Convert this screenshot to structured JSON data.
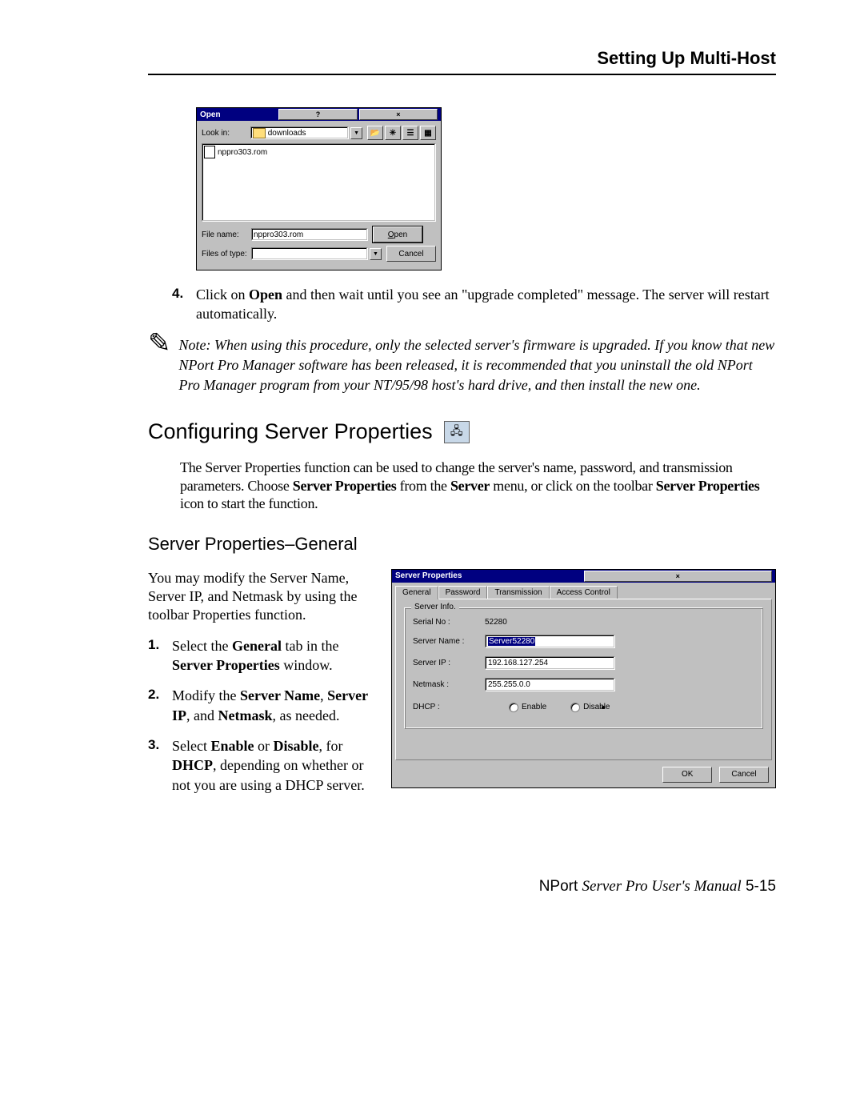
{
  "header": {
    "title": "Setting Up Multi-Host"
  },
  "open_dialog": {
    "title": "Open",
    "help_glyph": "?",
    "close_glyph": "×",
    "look_in_label": "Look in:",
    "look_in_value": "downloads",
    "up_glyph": "📂",
    "new_glyph": "✳",
    "list_glyph": "☰",
    "detail_glyph": "▦",
    "file_item": "nppro303.rom",
    "filename_label": "File name:",
    "filename_value": "nppro303.rom",
    "filetype_label": "Files of type:",
    "filetype_value": "",
    "open_btn": "Open",
    "cancel_btn": "Cancel"
  },
  "step4": {
    "num": "4.",
    "text_a": "Click on ",
    "bold_a": "Open",
    "text_b": " and then wait until you see an \"upgrade completed\" message. The server will restart automatically."
  },
  "note": {
    "icon": "✎",
    "text": "Note: When using this procedure, only the selected server's firmware is upgraded. If you know that new NPort Pro Manager software has been released, it is recommended that you uninstall the old NPort Pro Manager program from your NT/95/98 host's hard drive, and then install the new one."
  },
  "section": {
    "title": "Configuring Server Properties",
    "icon": "🖧"
  },
  "intro": {
    "pre": "The Server Properties function can be used to change the server's name, password, and transmission parameters. Choose ",
    "b1": "Server Properties",
    "mid1": " from the ",
    "b2": "Server",
    "mid2": " menu, or click on the toolbar ",
    "b3": "Server Properties",
    "post": " icon to start the function."
  },
  "subsection": {
    "title": "Server Properties–General"
  },
  "left": {
    "p1": "You may modify the Server Name, Server IP, and Netmask by using the toolbar Properties function.",
    "s1": {
      "num": "1.",
      "a": "Select the ",
      "b1": "General",
      "mid": " tab in the ",
      "b2": "Server Properties",
      "end": " window."
    },
    "s2": {
      "num": "2.",
      "a": "Modify the ",
      "b1": "Server Name",
      "c": ", ",
      "b2": "Server IP",
      "d": ", and ",
      "b3": "Netmask",
      "e": ", as needed."
    },
    "s3": {
      "num": "3.",
      "a": "Select ",
      "b1": "Enable",
      "mid": " or ",
      "b2": "Disable",
      "mid2": ", for ",
      "b3": "DHCP",
      "e": ", depending on whether or not you are using a DHCP server."
    }
  },
  "sp_dialog": {
    "title": "Server Properties",
    "close_glyph": "×",
    "tabs": [
      "General",
      "Password",
      "Transmission",
      "Access Control"
    ],
    "group_title": "Server Info.",
    "serial_lbl": "Serial No :",
    "serial_val": "52280",
    "name_lbl": "Server Name :",
    "name_val": "Server52280",
    "ip_lbl": "Server IP :",
    "ip_val": "192.168.127.254",
    "mask_lbl": "Netmask :",
    "mask_val": "255.255.0.0",
    "dhcp_lbl": "DHCP :",
    "enable": "Enable",
    "disable": "Disable",
    "ok": "OK",
    "cancel": "Cancel"
  },
  "footer": {
    "a": "NPort ",
    "b": "Server Pro User's Manual",
    "c": "   5-15"
  }
}
